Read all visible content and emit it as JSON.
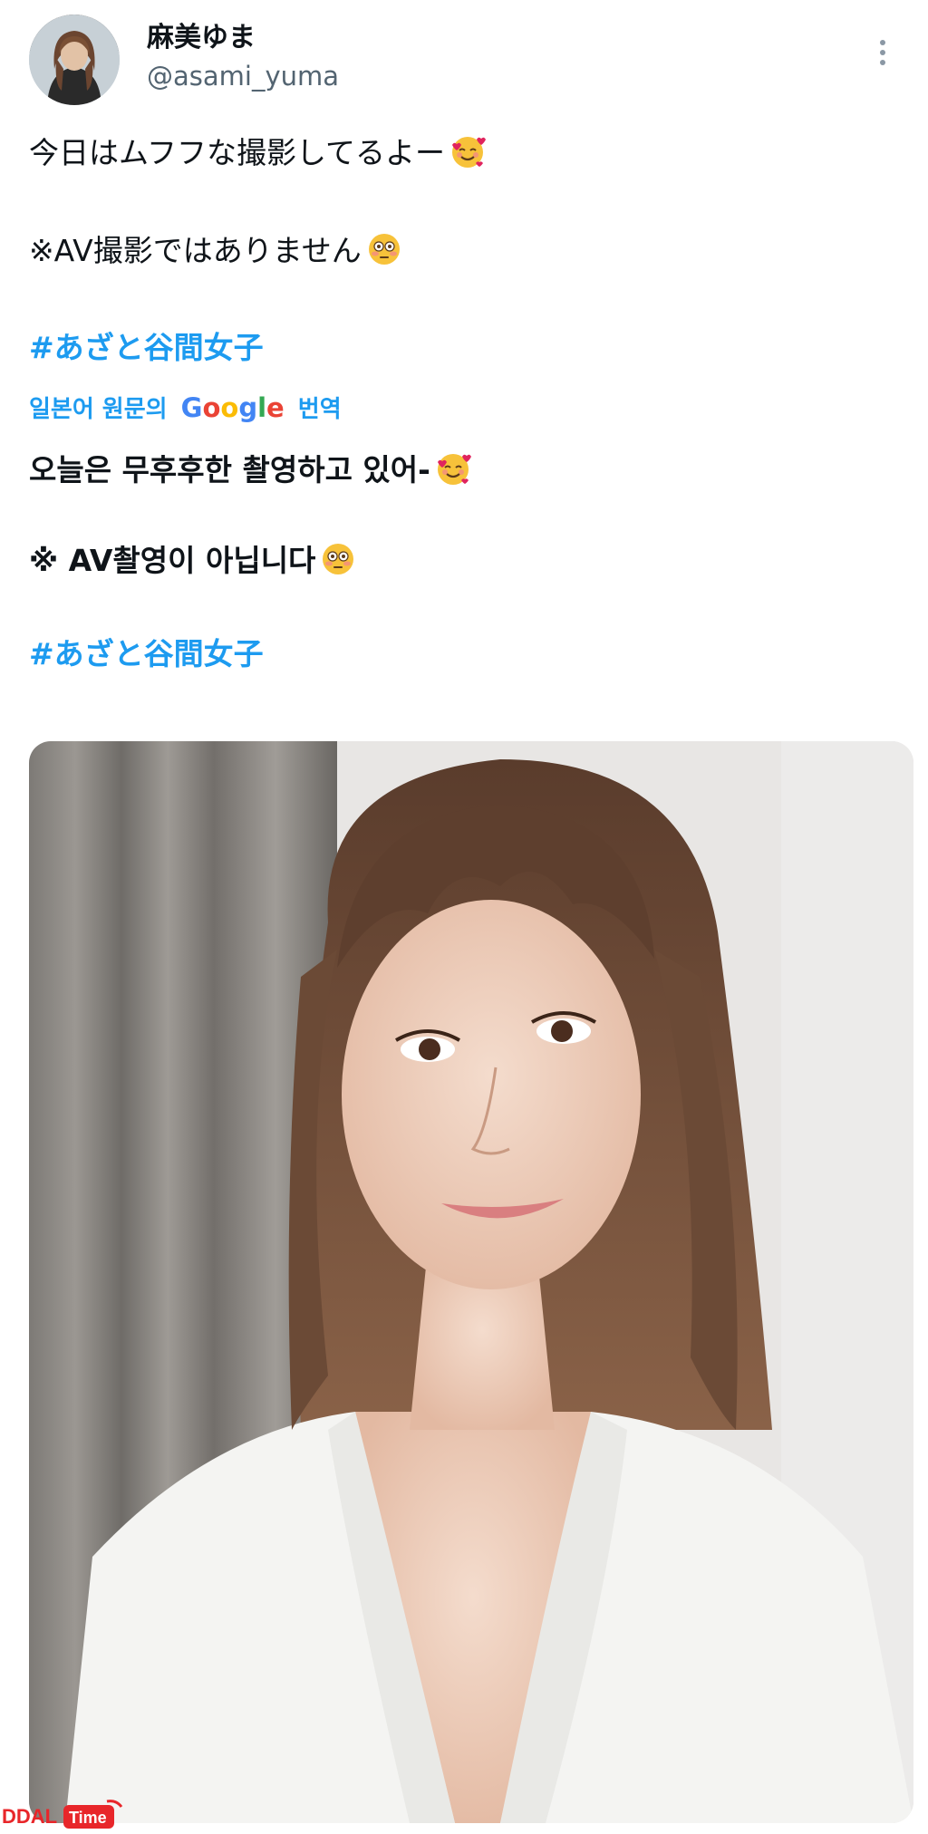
{
  "user": {
    "display_name": "麻美ゆま",
    "handle": "@asami_yuma"
  },
  "tweet": {
    "line1": "今日はムフフな撮影してるよー",
    "line2": "※AV撮影ではありません",
    "hashtag": "#あざと谷間女子"
  },
  "translation": {
    "prefix": "일본어 원문의",
    "provider": "Google",
    "suffix": "번역",
    "line1": "오늘은 무후후한 촬영하고 있어-",
    "line2": "※ AV촬영이 아닙니다",
    "hashtag": "#あざと谷間女子"
  },
  "emojis": {
    "smiling_hearts": "smiling-face-with-hearts-icon",
    "flushed": "flushed-face-icon"
  },
  "watermark": {
    "brand": "DDAL",
    "sub": "Time"
  },
  "colors": {
    "link": "#1d9bf0",
    "text": "#0f1419",
    "muted": "#536471"
  }
}
